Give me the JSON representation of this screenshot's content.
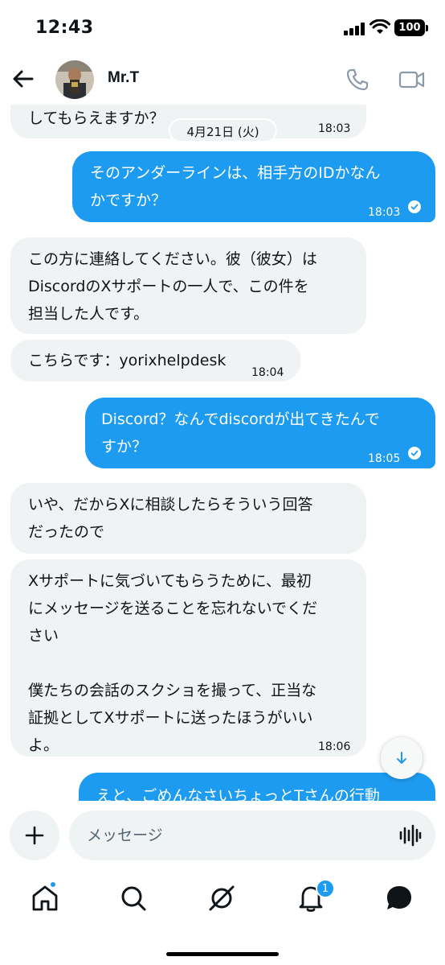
{
  "status_bar": {
    "time": "12:43",
    "battery": "100"
  },
  "header": {
    "contact_name": "Mr.T",
    "icons": [
      "back-arrow-icon",
      "phone-icon",
      "video-camera-icon"
    ]
  },
  "date_separator": "4月21日 (火)",
  "messages": [
    {
      "direction": "in",
      "text": "してもらえますか？",
      "time": "18:03"
    },
    {
      "direction": "out",
      "text": "そのアンダーラインは、相手方のIDかなん\nかですか？",
      "time": "18:03",
      "read": true
    },
    {
      "direction": "in",
      "text": "この方に連絡してください。彼（彼女）は\nDiscordのXサポートの一人で、この件を\n担当した人です。",
      "time": ""
    },
    {
      "direction": "in",
      "text": "こちらです：yorixhelpdesk",
      "time": "18:04"
    },
    {
      "direction": "out",
      "text": "Discord？なんでdiscordが出てきたんで\nすか？",
      "time": "18:05",
      "read": true
    },
    {
      "direction": "in",
      "text": "いや、だからXに相談したらそういう回答\nだったので",
      "time": ""
    },
    {
      "direction": "in",
      "text": "Xサポートに気づいてもらうために、最初\nにメッセージを送ることを忘れないでくだ\nさい\n\n僕たちの会話のスクショを撮って、正当な\n証拠としてXサポートに送ったほうがいい\nよ。",
      "time": "18:06"
    },
    {
      "direction": "out",
      "text": "えと、ごめんなさいちょっとTさんの行動",
      "time": ""
    }
  ],
  "composer": {
    "placeholder": "メッセージ"
  },
  "bottom_nav": {
    "items": [
      "home-icon",
      "search-icon",
      "grok-icon",
      "notifications-icon",
      "messages-icon"
    ],
    "notification_count": "1"
  },
  "colors": {
    "accent": "#1d9bf0",
    "incoming_bubble": "#eff3f4",
    "text": "#0f1419"
  }
}
